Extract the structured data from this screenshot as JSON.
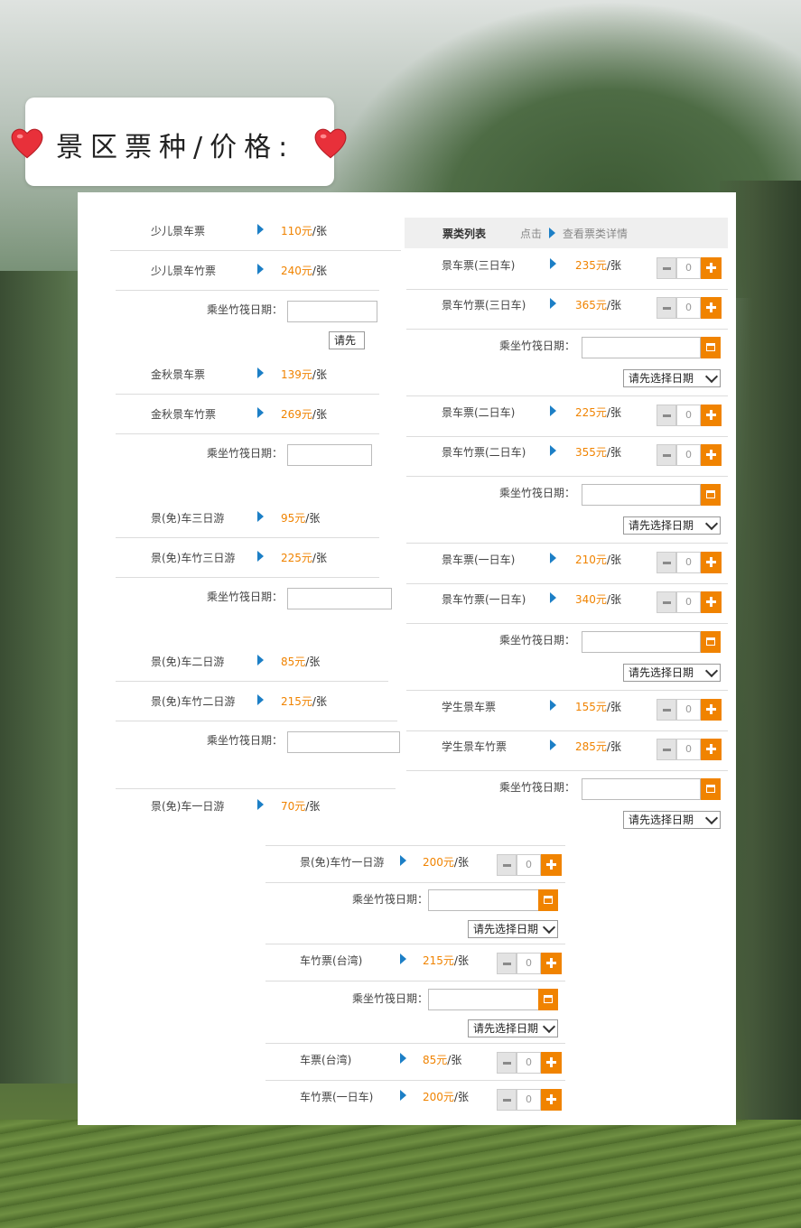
{
  "title": "景区票种/价格:",
  "colors": {
    "accent": "#f08300",
    "arrow": "#1c7fc6",
    "heart": "#e8303a"
  },
  "header": {
    "list_label": "票类列表",
    "click_label": "点击",
    "detail_label": "查看票类详情"
  },
  "labels": {
    "date_label": "乘坐竹筏日期：",
    "select_placeholder": "请先选择日期",
    "select_short": "请先",
    "qty_default": "0"
  },
  "left_tickets": [
    {
      "name": "少儿景车票",
      "price": "110元",
      "unit": "/张"
    },
    {
      "name": "少儿景车竹票",
      "price": "240元",
      "unit": "/张"
    },
    {
      "name": "金秋景车票",
      "price": "139元",
      "unit": "/张"
    },
    {
      "name": "金秋景车竹票",
      "price": "269元",
      "unit": "/张"
    },
    {
      "name": "景(免)车三日游",
      "price": "95元",
      "unit": "/张"
    },
    {
      "name": "景(免)车竹三日游",
      "price": "225元",
      "unit": "/张"
    },
    {
      "name": "景(免)车二日游",
      "price": "85元",
      "unit": "/张"
    },
    {
      "name": "景(免)车竹二日游",
      "price": "215元",
      "unit": "/张"
    },
    {
      "name": "景(免)车一日游",
      "price": "70元",
      "unit": "/张"
    }
  ],
  "right_tickets": [
    {
      "name": "景车票(三日车)",
      "price": "235元",
      "unit": "/张"
    },
    {
      "name": "景车竹票(三日车)",
      "price": "365元",
      "unit": "/张"
    },
    {
      "name": "景车票(二日车)",
      "price": "225元",
      "unit": "/张"
    },
    {
      "name": "景车竹票(二日车)",
      "price": "355元",
      "unit": "/张"
    },
    {
      "name": "景车票(一日车)",
      "price": "210元",
      "unit": "/张"
    },
    {
      "name": "景车竹票(一日车)",
      "price": "340元",
      "unit": "/张"
    },
    {
      "name": "学生景车票",
      "price": "155元",
      "unit": "/张"
    },
    {
      "name": "学生景车竹票",
      "price": "285元",
      "unit": "/张"
    }
  ],
  "bottom_tickets": [
    {
      "name": "景(免)车竹一日游",
      "price": "200元",
      "unit": "/张"
    },
    {
      "name": "车竹票(台湾)",
      "price": "215元",
      "unit": "/张"
    },
    {
      "name": "车票(台湾)",
      "price": "85元",
      "unit": "/张"
    },
    {
      "name": "车竹票(一日车)",
      "price": "200元",
      "unit": "/张"
    }
  ]
}
